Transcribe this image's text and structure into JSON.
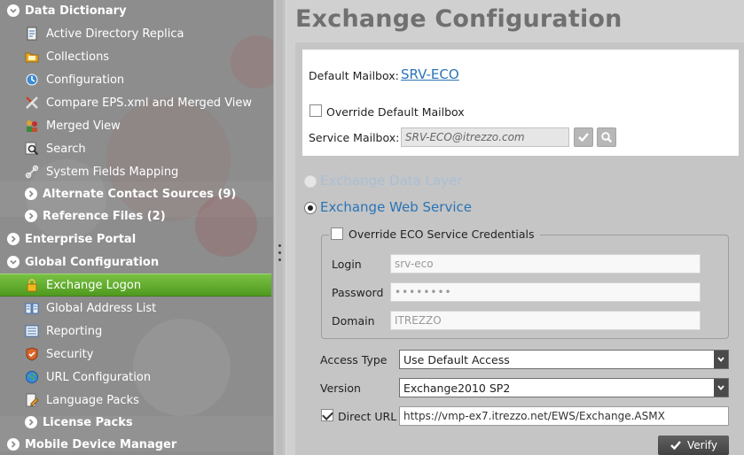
{
  "sidebar": {
    "sections": {
      "data_dictionary": "Data Dictionary",
      "enterprise_portal": "Enterprise Portal",
      "global_configuration": "Global Configuration",
      "mobile_device_manager": "Mobile Device Manager"
    },
    "data_dictionary_items": {
      "active_directory_replica": "Active Directory Replica",
      "collections": "Collections",
      "configuration": "Configuration",
      "compare_eps": "Compare EPS.xml and Merged View",
      "merged_view": "Merged View",
      "search": "Search",
      "system_fields_mapping": "System Fields Mapping",
      "alternate_contact_sources": "Alternate Contact Sources (9)",
      "reference_files": "Reference Files (2)"
    },
    "global_configuration_items": {
      "exchange_logon": "Exchange Logon",
      "global_address_list": "Global Address List",
      "reporting": "Reporting",
      "security": "Security",
      "url_configuration": "URL Configuration",
      "language_packs": "Language Packs",
      "license_packs": "License Packs"
    },
    "selected": "Exchange Logon"
  },
  "main": {
    "title": "Exchange Configuration",
    "default_mailbox_label": "Default Mailbox:",
    "default_mailbox_value": "SRV-ECO",
    "override_default_mailbox_label": "Override Default Mailbox",
    "override_default_mailbox_checked": false,
    "service_mailbox_label": "Service Mailbox:",
    "service_mailbox_value": "SRV-ECO@itrezzo.com",
    "radio_exchange_data_layer": "Exchange Data Layer",
    "radio_exchange_web_service": "Exchange Web Service",
    "selected_radio": "Exchange Web Service",
    "override_credentials_label": "Override ECO Service Credentials",
    "override_credentials_checked": false,
    "login_label": "Login",
    "login_value": "srv-eco",
    "password_label": "Password",
    "password_value": "••••••••",
    "domain_label": "Domain",
    "domain_value": "ITREZZO",
    "access_type_label": "Access Type",
    "access_type_value": "Use Default Access",
    "version_label": "Version",
    "version_value": "Exchange2010 SP2",
    "direct_url_label": "Direct URL",
    "direct_url_checked": true,
    "direct_url_value": "https://vmp-ex7.itrezzo.net/EWS/Exchange.ASMX",
    "verify_label": "Verify"
  },
  "colors": {
    "sidebar_bg": "#8d8d8d",
    "selected_item": "#5fa82c",
    "link_blue": "#2b74b7",
    "title_grey": "#707070"
  }
}
